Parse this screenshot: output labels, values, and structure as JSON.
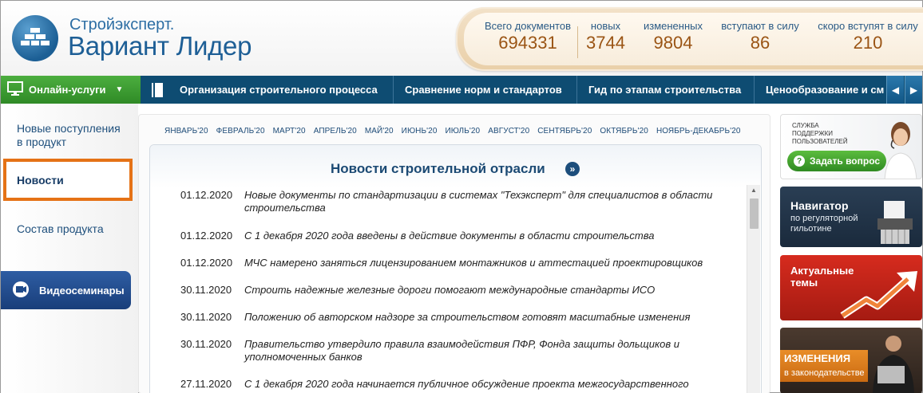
{
  "header": {
    "logo_line1": "Стройэксперт.",
    "logo_line2": "Вариант Лидер",
    "stats": [
      {
        "label": "Всего документов",
        "value": "694331"
      },
      {
        "label": "новых",
        "value": "3744"
      },
      {
        "label": "измененных",
        "value": "9804"
      },
      {
        "label": "вступают в силу",
        "value": "86"
      },
      {
        "label": "скоро вступят в силу",
        "value": "210"
      }
    ]
  },
  "nav": {
    "online_label": "Онлайн-услуги",
    "items": [
      "Организация строительного процесса",
      "Сравнение норм и стандартов",
      "Гид по этапам строительства",
      "Ценообразование и см"
    ]
  },
  "left_menu": {
    "items": [
      "Новые поступления в продукт",
      "Новости",
      "Состав продукта"
    ],
    "video_label": "Видеосеминары"
  },
  "main": {
    "months": [
      "ЯНВАРЬ'20",
      "ФЕВРАЛЬ'20",
      "МАРТ'20",
      "АПРЕЛЬ'20",
      "МАЙ'20",
      "ИЮНЬ'20",
      "ИЮЛЬ'20",
      "АВГУСТ'20",
      "СЕНТЯБРЬ'20",
      "ОКТЯБРЬ'20",
      "НОЯБРЬ-ДЕКАБРЬ'20"
    ],
    "news_title": "Новости строительной отрасли",
    "news": [
      {
        "date": "01.12.2020",
        "text": "Новые документы по стандартизации в системах \"Техэксперт\" для специалистов в области строительства"
      },
      {
        "date": "01.12.2020",
        "text": "С 1 декабря 2020 года введены в действие документы в области строительства"
      },
      {
        "date": "01.12.2020",
        "text": "МЧС намерено заняться лицензированием монтажников и аттестацией проектировщиков"
      },
      {
        "date": "30.11.2020",
        "text": "Строить надежные железные дороги помогают международные стандарты ИСО"
      },
      {
        "date": "30.11.2020",
        "text": "Положению об авторском надзоре за строительством готовят масштабные изменения"
      },
      {
        "date": "30.11.2020",
        "text": "Правительство утвердило правила взаимодействия ПФР, Фонда защиты дольщиков и уполномоченных банков"
      },
      {
        "date": "27.11.2020",
        "text": "С 1 декабря 2020 года начинается публичное обсуждение проекта межгосударственного"
      }
    ]
  },
  "banners": {
    "support_small": "СЛУЖБА ПОДДЕРЖКИ ПОЛЬЗОВАТЕЛЕЙ",
    "support_button": "Задать вопрос",
    "navigator_title": "Навигатор",
    "navigator_sub": "по регуляторной гильотине",
    "topics_title": "Актуальные темы",
    "changes_title": "ИЗМЕНЕНИЯ",
    "changes_sub": "в законодательстве"
  },
  "colors": {
    "nav_blue": "#0e4c72",
    "online_green": "#2f8a26",
    "highlight_orange": "#e57216",
    "stat_number": "#9a5414"
  }
}
